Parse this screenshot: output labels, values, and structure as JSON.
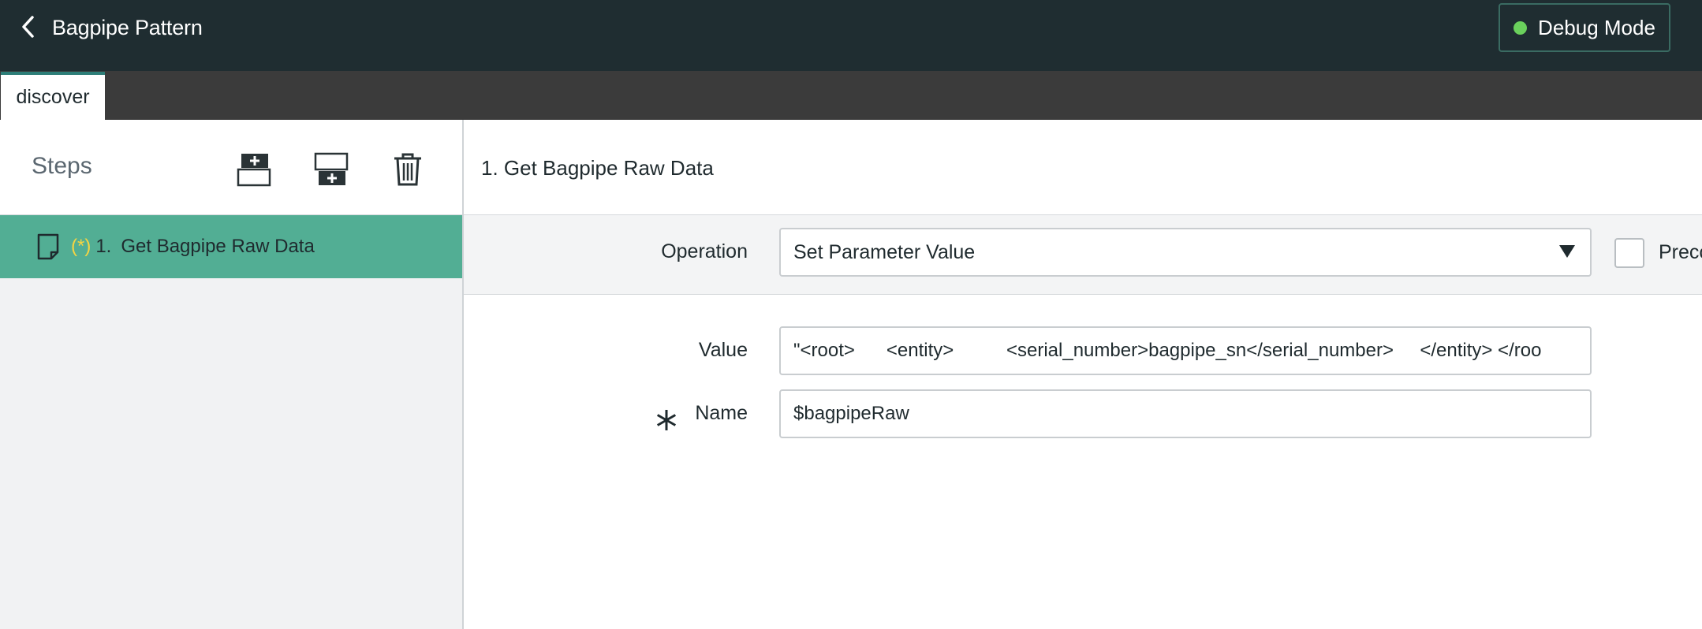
{
  "header": {
    "back_icon": "chevron-left-icon",
    "title": "Bagpipe Pattern",
    "debug_button": {
      "label": "Debug Mode",
      "status_color": "#6ad05c"
    }
  },
  "tabs": [
    {
      "label": "discover",
      "active": true
    }
  ],
  "steps_panel": {
    "title": "Steps",
    "toolbar_icons": [
      "insert-step-above-icon",
      "insert-step-below-icon",
      "trash-icon"
    ],
    "items": [
      {
        "marker": "(*)",
        "number": "1.",
        "label": "Get Bagpipe Raw Data",
        "icon": "document-icon",
        "selected": true
      }
    ]
  },
  "step_detail": {
    "title": "1. Get Bagpipe Raw Data",
    "operation": {
      "label": "Operation",
      "selected_value": "Set Parameter Value"
    },
    "checkbox_label": "Precc",
    "value_field": {
      "label": "Value",
      "value": "\"<root>      <entity>          <serial_number>bagpipe_sn</serial_number>     </entity> </roo"
    },
    "name_field": {
      "label": "Name",
      "required": true,
      "value": "$bagpipeRaw"
    }
  },
  "colors": {
    "header_bg": "#1f2d31",
    "tabstrip_bg": "#3b3b3b",
    "selected_step_bg": "#52ae94",
    "tab_accent": "#2d7e78"
  }
}
